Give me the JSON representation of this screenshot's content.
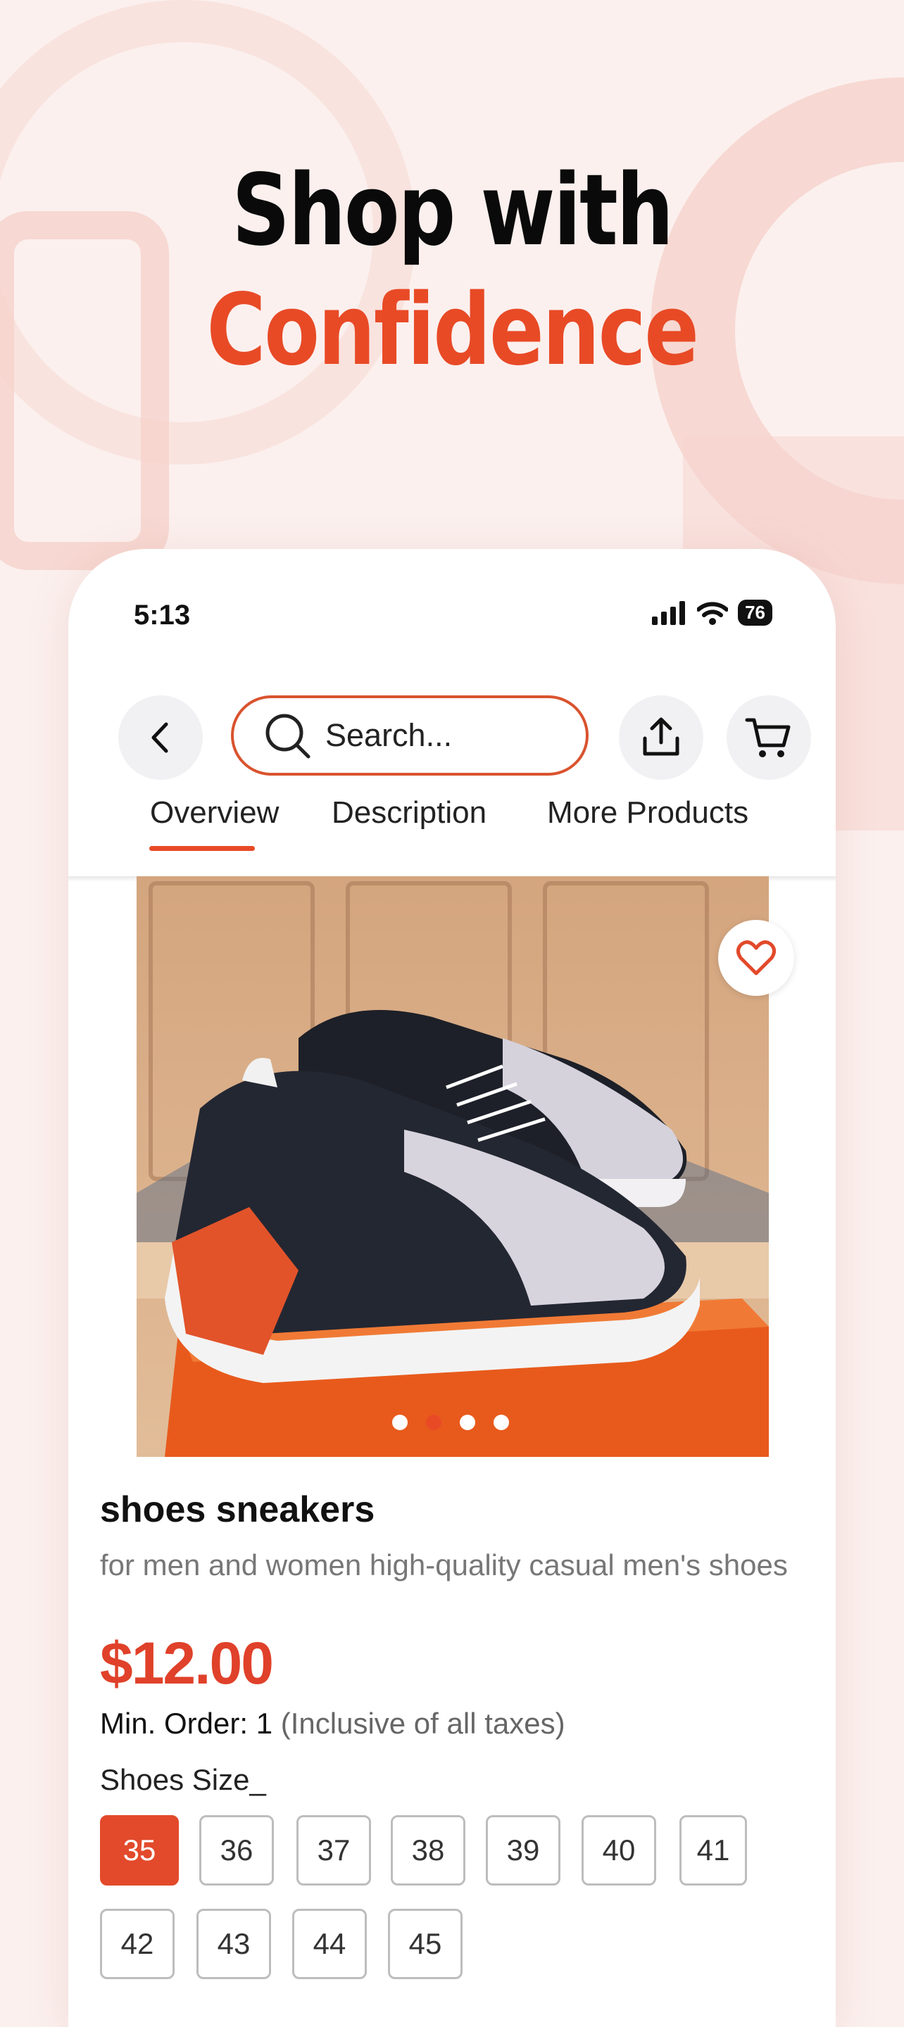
{
  "headline": {
    "line1": "Shop with",
    "line2": "Confidence"
  },
  "status_bar": {
    "time": "5:13",
    "battery": "76"
  },
  "nav": {
    "back_icon": "chevron-left-icon",
    "search_placeholder": "Search...",
    "share_icon": "share-icon",
    "cart_icon": "cart-icon"
  },
  "tabs": [
    {
      "label": "Overview",
      "active": true
    },
    {
      "label": "Description",
      "active": false
    },
    {
      "label": "More Products",
      "active": false
    }
  ],
  "gallery": {
    "image_count": 4,
    "active_index": 1,
    "favorite_icon": "heart-icon"
  },
  "product": {
    "title": "shoes sneakers",
    "subtitle": "for men and women high-quality casual men's shoes",
    "price": "$12.00",
    "min_order_label": "Min. Order: 1",
    "tax_note": "(Inclusive of all taxes)",
    "size_label": "Shoes Size_",
    "sizes": [
      "35",
      "36",
      "37",
      "38",
      "39",
      "40",
      "41",
      "42",
      "43",
      "44",
      "45"
    ],
    "selected_size": "35"
  },
  "colors": {
    "accent": "#e84a26",
    "background": "#fbf0ee"
  }
}
